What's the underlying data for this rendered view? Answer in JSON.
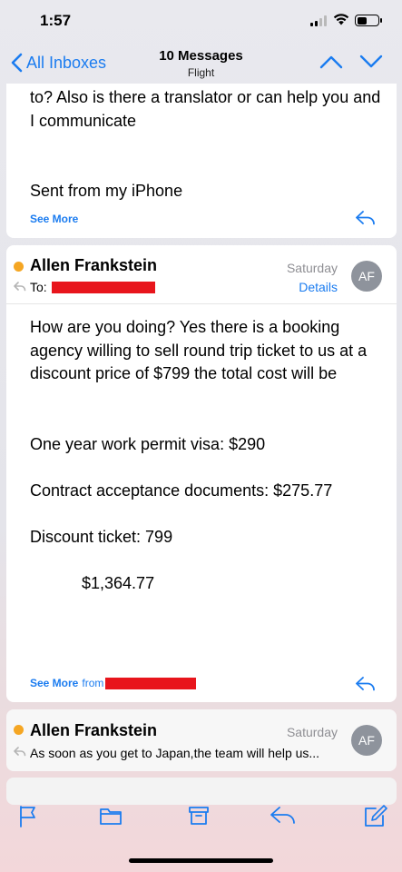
{
  "status_bar": {
    "time": "1:57"
  },
  "nav": {
    "back_label": "All Inboxes",
    "title": "10 Messages",
    "subtitle": "Flight"
  },
  "message_prev": {
    "body": "to? Also is there a translator or can help you and I communicate",
    "signature": "Sent from my iPhone",
    "see_more": "See More"
  },
  "message_main": {
    "sender": "Allen Frankstein",
    "to_label": "To:",
    "date": "Saturday",
    "details_label": "Details",
    "avatar_initials": "AF",
    "paragraphs": [
      "How are you doing? Yes there is a booking agency willing to sell round trip ticket to us at a discount price of $799 the total cost will be",
      "One year work permit visa: $290",
      "Contract acceptance documents: $275.77",
      "Discount ticket: 799",
      "$1,364.77"
    ],
    "see_more": "See More",
    "from_label": "from"
  },
  "message_next": {
    "sender": "Allen Frankstein",
    "date": "Saturday",
    "avatar_initials": "AF",
    "snippet": "As soon as you get to Japan,the team will help us..."
  },
  "toolbar": {
    "icons": [
      "flag-icon",
      "folder-icon",
      "archive-icon",
      "reply-icon",
      "compose-icon"
    ]
  },
  "colors": {
    "accent": "#1b7cf0",
    "unread_dot": "#f5a623",
    "redaction": "#e8151c",
    "avatar": "#8e939c"
  }
}
